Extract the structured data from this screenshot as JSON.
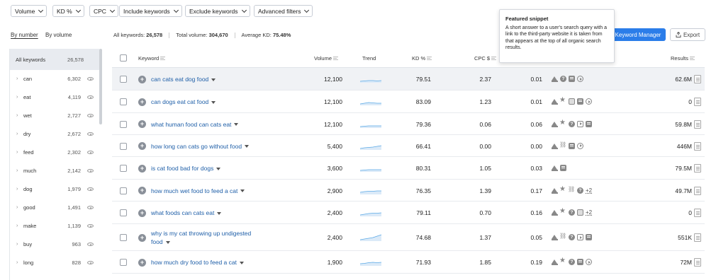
{
  "filters": {
    "volume": "Volume",
    "kd": "KD %",
    "cpc": "CPC",
    "include": "Include keywords",
    "exclude": "Exclude keywords",
    "advanced": "Advanced filters"
  },
  "tabs": {
    "by_number": "By number",
    "by_volume": "By volume"
  },
  "summary": {
    "all_keywords_label": "All keywords:",
    "all_keywords_value": "26,578",
    "total_volume_label": "Total volume:",
    "total_volume_value": "304,670",
    "avg_kd_label": "Average KD:",
    "avg_kd_value": "75.48%"
  },
  "buttons": {
    "keyword_manager": "Keyword Manager",
    "export": "Export"
  },
  "sidebar": {
    "items": [
      {
        "label": "All keywords",
        "count": "26,578"
      },
      {
        "label": "can",
        "count": "6,302"
      },
      {
        "label": "eat",
        "count": "4,119"
      },
      {
        "label": "wet",
        "count": "2,727"
      },
      {
        "label": "dry",
        "count": "2,672"
      },
      {
        "label": "feed",
        "count": "2,302"
      },
      {
        "label": "much",
        "count": "2,142"
      },
      {
        "label": "dog",
        "count": "1,979"
      },
      {
        "label": "good",
        "count": "1,491"
      },
      {
        "label": "make",
        "count": "1,139"
      },
      {
        "label": "buy",
        "count": "963"
      },
      {
        "label": "long",
        "count": "828"
      }
    ]
  },
  "table": {
    "headers": {
      "keyword": "Keyword",
      "volume": "Volume",
      "trend": "Trend",
      "kd": "KD %",
      "cpc": "CPC $",
      "results": "Results"
    },
    "rows": [
      {
        "keyword_l1": "can cats eat dog food",
        "keyword_l2": "",
        "volume": "12,100",
        "kd": "79.51",
        "cpc": "2.37",
        "com": "0.01",
        "serp": [
          "crown",
          "q",
          "snip",
          "play"
        ],
        "more": "",
        "results": "62.6M"
      },
      {
        "keyword_l1": "can dogs eat cat food",
        "keyword_l2": "",
        "volume": "12,100",
        "kd": "83.09",
        "cpc": "1.23",
        "com": "0.01",
        "serp": [
          "crown",
          "star",
          "img",
          "snip",
          "play"
        ],
        "more": "",
        "results": "0"
      },
      {
        "keyword_l1": "what human food can cats eat",
        "keyword_l2": "",
        "volume": "12,100",
        "kd": "79.36",
        "cpc": "0.06",
        "com": "0.06",
        "serp": [
          "crown",
          "star",
          "q",
          "video",
          "snip"
        ],
        "more": "",
        "results": "59.8M"
      },
      {
        "keyword_l1": "how long can cats go without food",
        "keyword_l2": "",
        "volume": "5,400",
        "kd": "66.41",
        "cpc": "0.00",
        "com": "0.00",
        "serp": [
          "crown",
          "link",
          "snip",
          "play"
        ],
        "more": "",
        "results": "446M"
      },
      {
        "keyword_l1": "is cat food bad for dogs",
        "keyword_l2": "",
        "volume": "3,600",
        "kd": "80.31",
        "cpc": "1.05",
        "com": "0.03",
        "serp": [
          "crown",
          "snip"
        ],
        "more": "",
        "results": "79.5M"
      },
      {
        "keyword_l1": "how much wet food to feed a cat",
        "keyword_l2": "",
        "volume": "2,900",
        "kd": "76.35",
        "cpc": "1.39",
        "com": "0.17",
        "serp": [
          "crown",
          "star",
          "link",
          "q"
        ],
        "more": "+2",
        "results": "49.7M"
      },
      {
        "keyword_l1": "what foods can cats eat",
        "keyword_l2": "",
        "volume": "2,400",
        "kd": "79.11",
        "cpc": "0.70",
        "com": "0.16",
        "serp": [
          "crown",
          "star",
          "q",
          "img"
        ],
        "more": "+2",
        "results": "0"
      },
      {
        "keyword_l1": "why is my cat throwing up undigested",
        "keyword_l2": "food",
        "volume": "2,400",
        "kd": "74.68",
        "cpc": "1.37",
        "com": "0.05",
        "serp": [
          "crown",
          "link",
          "q",
          "video",
          "snip"
        ],
        "more": "",
        "results": "551K"
      },
      {
        "keyword_l1": "how much dry food to feed a cat",
        "keyword_l2": "",
        "volume": "1,900",
        "kd": "71.93",
        "cpc": "1.85",
        "com": "0.19",
        "serp": [
          "crown",
          "star",
          "q",
          "snip",
          "play"
        ],
        "more": "",
        "results": "72M"
      }
    ]
  },
  "tooltip": {
    "title": "Featured snippet",
    "body": "A short answer to a user's search query with a link to the third-party website it is taken from that appears at the top of all organic search results."
  },
  "colors": {
    "accent": "#2b7de9",
    "link": "#1f5fa8",
    "trend": "#5aa9e6"
  }
}
